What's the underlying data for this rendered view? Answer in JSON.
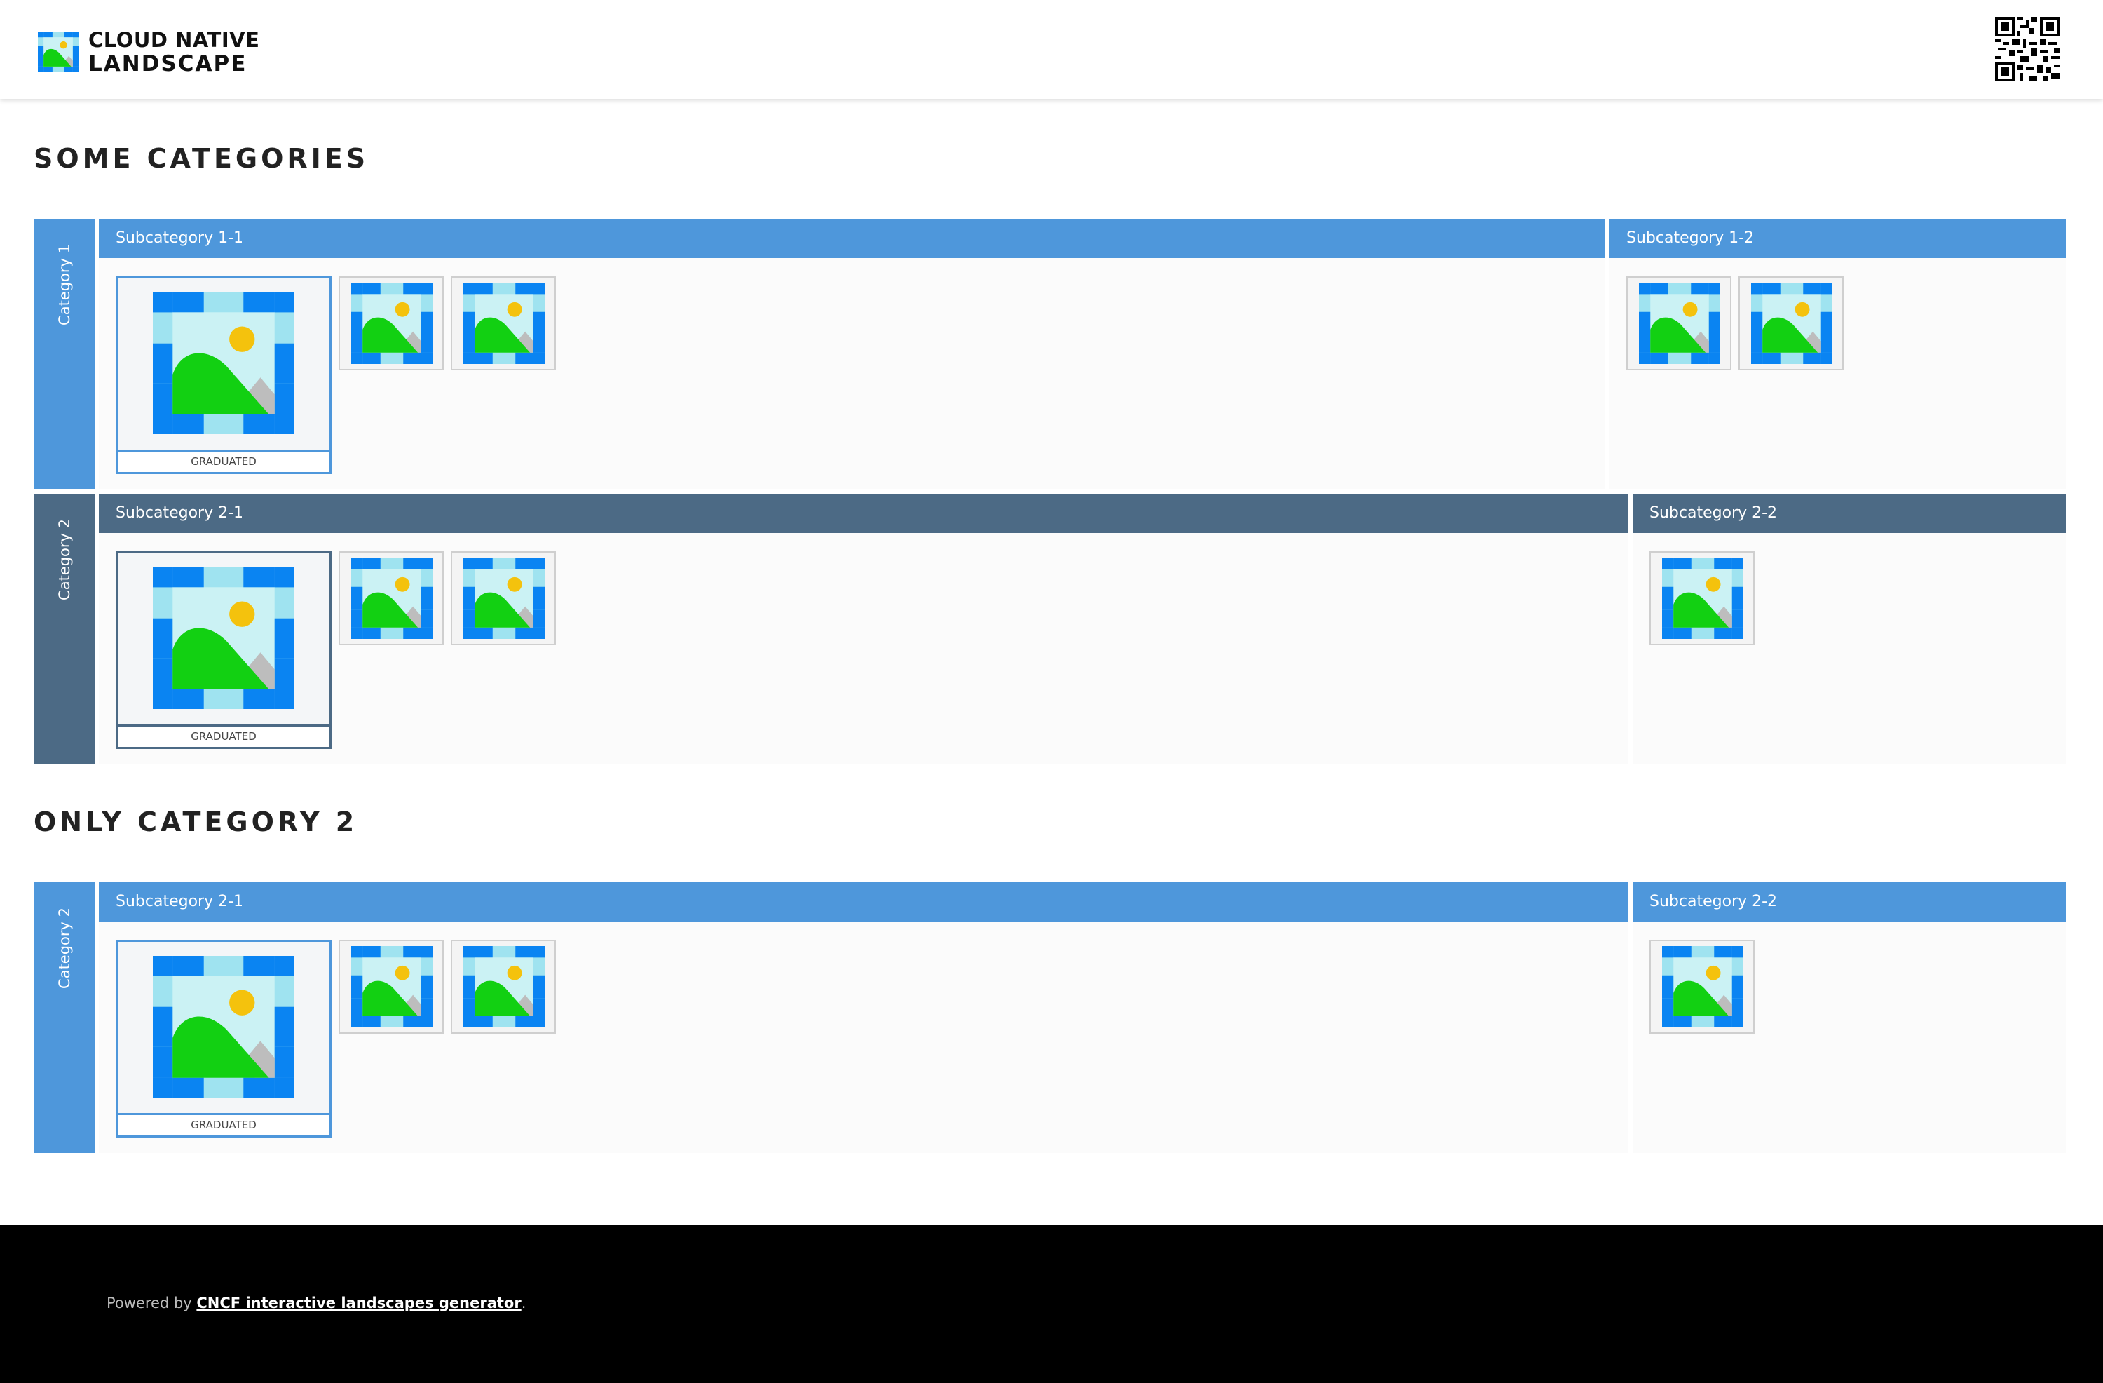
{
  "header": {
    "logo_line1": "CLOUD NATIVE",
    "logo_line2": "LANDSCAPE",
    "logo_icon": "landscape-image-icon",
    "qr_icon": "qr-code-icon"
  },
  "sections": [
    {
      "title": "SOME CATEGORIES",
      "categories": [
        {
          "label": "Category 1",
          "color": "#4e97db",
          "subcategories": [
            {
              "label": "Subcategory 1-1",
              "badge": "GRADUATED",
              "small_items": 2
            },
            {
              "label": "Subcategory 1-2",
              "small_items": 2
            }
          ]
        },
        {
          "label": "Category 2",
          "color": "#4c6a85",
          "subcategories": [
            {
              "label": "Subcategory 2-1",
              "badge": "GRADUATED",
              "small_items": 2
            },
            {
              "label": "Subcategory 2-2",
              "small_items": 1
            }
          ]
        }
      ]
    },
    {
      "title": "ONLY CATEGORY 2",
      "categories": [
        {
          "label": "Category 2",
          "color": "#4e97db",
          "subcategories": [
            {
              "label": "Subcategory 2-1",
              "badge": "GRADUATED",
              "small_items": 2
            },
            {
              "label": "Subcategory 2-2",
              "small_items": 1
            }
          ]
        }
      ]
    }
  ],
  "footer": {
    "prefix": "Powered by ",
    "link_text": "CNCF interactive landscapes generator",
    "suffix": "."
  },
  "colors": {
    "blue": "#4e97db",
    "slate": "#4c6a85",
    "footer_bg": "#000000"
  }
}
